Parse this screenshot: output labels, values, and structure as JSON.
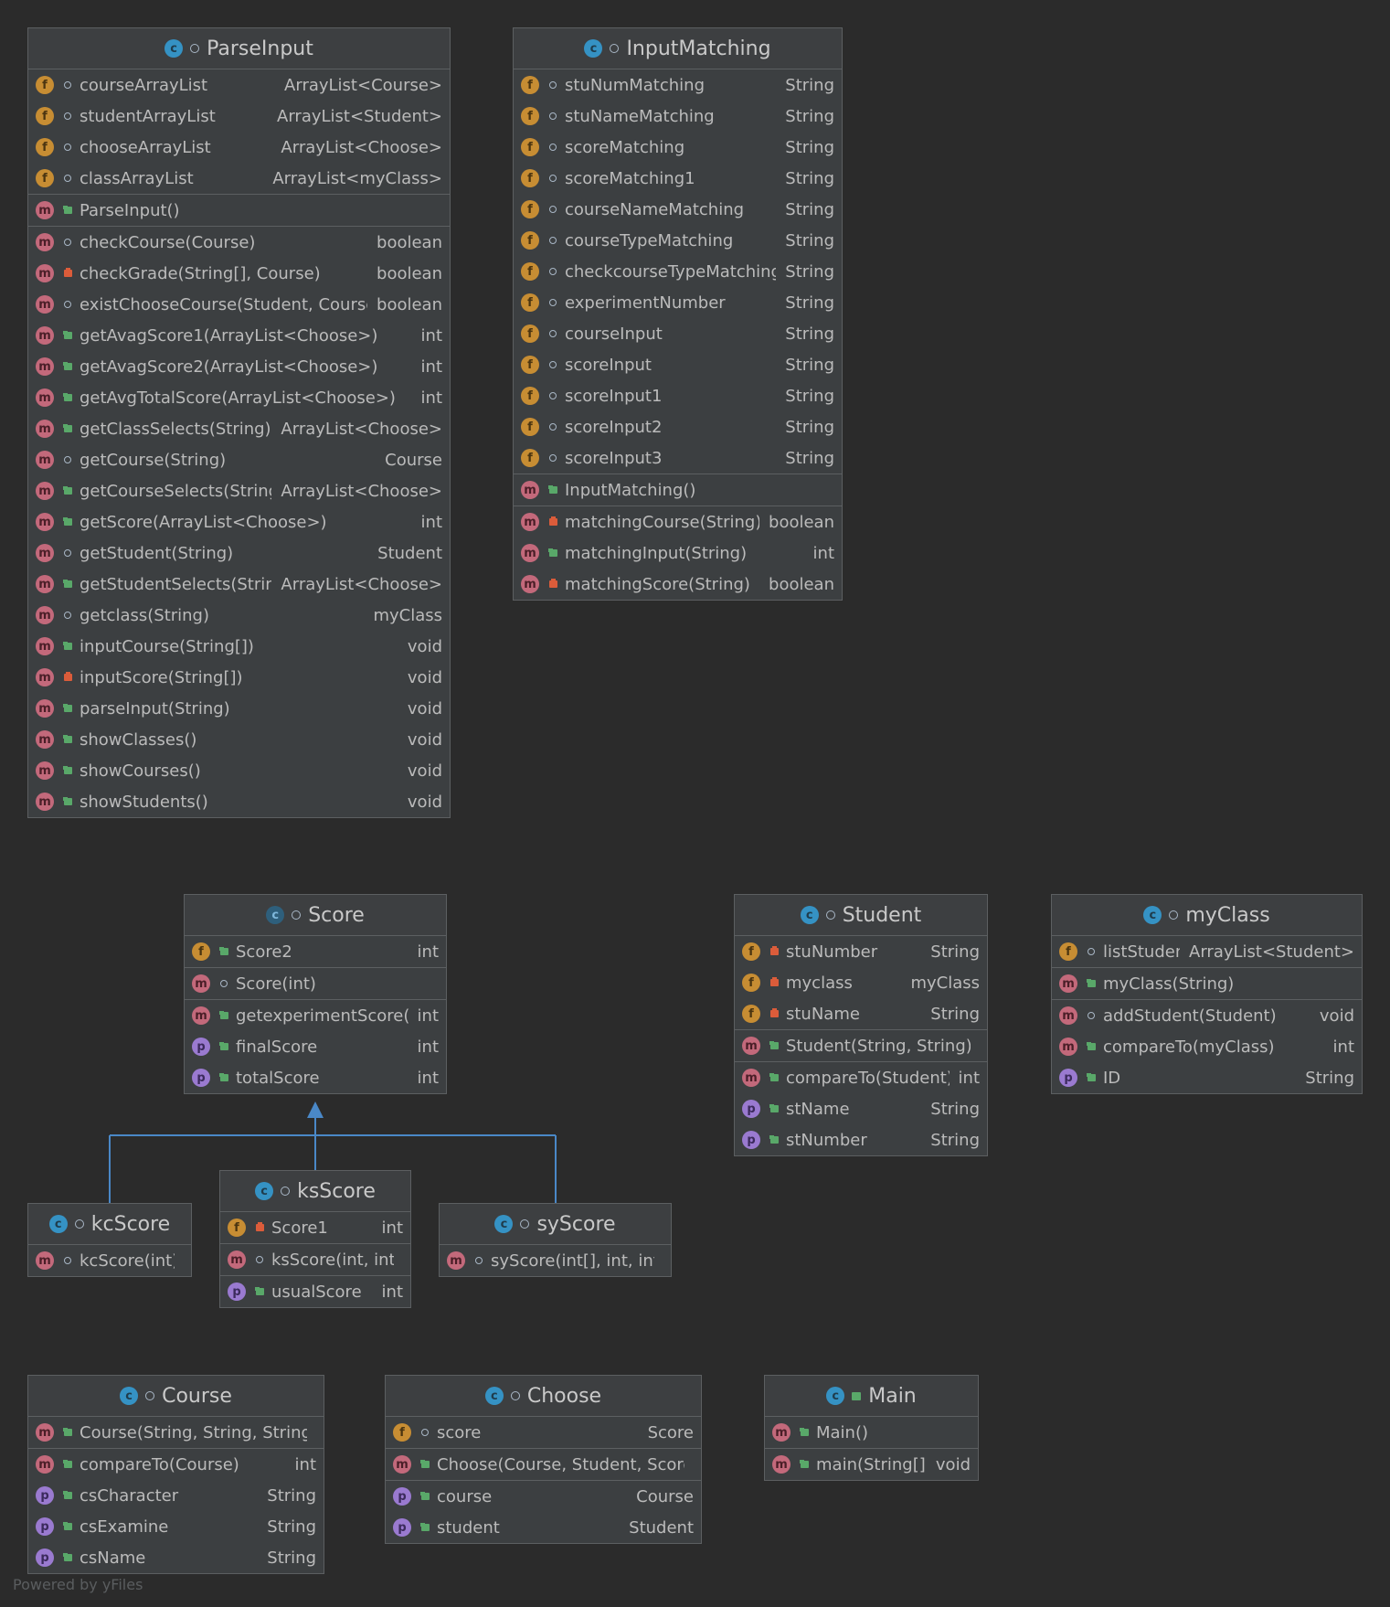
{
  "footer": "Powered by yFiles",
  "classes": [
    {
      "id": "ParseInput",
      "name": "ParseInput",
      "kind": "c",
      "vis": "pkg",
      "sections": [
        [
          {
            "k": "f",
            "v": "pkg",
            "n": "courseArrayList",
            "t": "ArrayList<Course>"
          },
          {
            "k": "f",
            "v": "pkg",
            "n": "studentArrayList",
            "t": "ArrayList<Student>"
          },
          {
            "k": "f",
            "v": "pkg",
            "n": "chooseArrayList",
            "t": "ArrayList<Choose>"
          },
          {
            "k": "f",
            "v": "pkg",
            "n": "classArrayList",
            "t": "ArrayList<myClass>"
          }
        ],
        [
          {
            "k": "m",
            "v": "pub",
            "n": "ParseInput()",
            "t": ""
          }
        ],
        [
          {
            "k": "m",
            "v": "pkg",
            "n": "checkCourse(Course)",
            "t": "boolean"
          },
          {
            "k": "m",
            "v": "priv",
            "n": "checkGrade(String[], Course)",
            "t": "boolean"
          },
          {
            "k": "m",
            "v": "pkg",
            "n": "existChooseCourse(Student, Course)",
            "t": "boolean"
          },
          {
            "k": "m",
            "v": "pub",
            "n": "getAvagScore1(ArrayList<Choose>)",
            "t": "int"
          },
          {
            "k": "m",
            "v": "pub",
            "n": "getAvagScore2(ArrayList<Choose>)",
            "t": "int"
          },
          {
            "k": "m",
            "v": "pub",
            "n": "getAvgTotalScore(ArrayList<Choose>)",
            "t": "int"
          },
          {
            "k": "m",
            "v": "pub",
            "n": "getClassSelects(String)",
            "t": "ArrayList<Choose>"
          },
          {
            "k": "m",
            "v": "pkg",
            "n": "getCourse(String)",
            "t": "Course"
          },
          {
            "k": "m",
            "v": "pub",
            "n": "getCourseSelects(String)",
            "t": "ArrayList<Choose>"
          },
          {
            "k": "m",
            "v": "pub",
            "n": "getScore(ArrayList<Choose>)",
            "t": "int"
          },
          {
            "k": "m",
            "v": "pkg",
            "n": "getStudent(String)",
            "t": "Student"
          },
          {
            "k": "m",
            "v": "pub",
            "n": "getStudentSelects(String)",
            "t": "ArrayList<Choose>"
          },
          {
            "k": "m",
            "v": "pkg",
            "n": "getclass(String)",
            "t": "myClass"
          },
          {
            "k": "m",
            "v": "pub",
            "n": "inputCourse(String[])",
            "t": "void"
          },
          {
            "k": "m",
            "v": "priv",
            "n": "inputScore(String[])",
            "t": "void"
          },
          {
            "k": "m",
            "v": "pub",
            "n": "parseInput(String)",
            "t": "void"
          },
          {
            "k": "m",
            "v": "pub",
            "n": "showClasses()",
            "t": "void"
          },
          {
            "k": "m",
            "v": "pub",
            "n": "showCourses()",
            "t": "void"
          },
          {
            "k": "m",
            "v": "pub",
            "n": "showStudents()",
            "t": "void"
          }
        ]
      ]
    },
    {
      "id": "InputMatching",
      "name": "InputMatching",
      "kind": "c",
      "vis": "pkg",
      "sections": [
        [
          {
            "k": "f",
            "v": "pkg",
            "n": "stuNumMatching",
            "t": "String"
          },
          {
            "k": "f",
            "v": "pkg",
            "n": "stuNameMatching",
            "t": "String"
          },
          {
            "k": "f",
            "v": "pkg",
            "n": "scoreMatching",
            "t": "String"
          },
          {
            "k": "f",
            "v": "pkg",
            "n": "scoreMatching1",
            "t": "String"
          },
          {
            "k": "f",
            "v": "pkg",
            "n": "courseNameMatching",
            "t": "String"
          },
          {
            "k": "f",
            "v": "pkg",
            "n": "courseTypeMatching",
            "t": "String"
          },
          {
            "k": "f",
            "v": "pkg",
            "n": "checkcourseTypeMatching",
            "t": "String"
          },
          {
            "k": "f",
            "v": "pkg",
            "n": "experimentNumber",
            "t": "String"
          },
          {
            "k": "f",
            "v": "pkg",
            "n": "courseInput",
            "t": "String"
          },
          {
            "k": "f",
            "v": "pkg",
            "n": "scoreInput",
            "t": "String"
          },
          {
            "k": "f",
            "v": "pkg",
            "n": "scoreInput1",
            "t": "String"
          },
          {
            "k": "f",
            "v": "pkg",
            "n": "scoreInput2",
            "t": "String"
          },
          {
            "k": "f",
            "v": "pkg",
            "n": "scoreInput3",
            "t": "String"
          }
        ],
        [
          {
            "k": "m",
            "v": "pub",
            "n": "InputMatching()",
            "t": ""
          }
        ],
        [
          {
            "k": "m",
            "v": "priv",
            "n": "matchingCourse(String)",
            "t": "boolean"
          },
          {
            "k": "m",
            "v": "pub",
            "n": "matchingInput(String)",
            "t": "int"
          },
          {
            "k": "m",
            "v": "priv",
            "n": "matchingScore(String)",
            "t": "boolean"
          }
        ]
      ]
    },
    {
      "id": "Score",
      "name": "Score",
      "kind": "a",
      "vis": "pkg",
      "sections": [
        [
          {
            "k": "f",
            "v": "pub",
            "n": "Score2",
            "t": "int"
          }
        ],
        [
          {
            "k": "m",
            "v": "pkg",
            "n": "Score(int)",
            "t": ""
          }
        ],
        [
          {
            "k": "m",
            "v": "pub",
            "n": "getexperimentScore()",
            "t": "int"
          },
          {
            "k": "p",
            "v": "pub",
            "n": "finalScore",
            "t": "int"
          },
          {
            "k": "p",
            "v": "pub",
            "n": "totalScore",
            "t": "int"
          }
        ]
      ]
    },
    {
      "id": "Student",
      "name": "Student",
      "kind": "c",
      "vis": "pkg",
      "sections": [
        [
          {
            "k": "f",
            "v": "priv",
            "n": "stuNumber",
            "t": "String"
          },
          {
            "k": "f",
            "v": "priv",
            "n": "myclass",
            "t": "myClass"
          },
          {
            "k": "f",
            "v": "priv",
            "n": "stuName",
            "t": "String"
          }
        ],
        [
          {
            "k": "m",
            "v": "pub",
            "n": "Student(String, String)",
            "t": ""
          }
        ],
        [
          {
            "k": "m",
            "v": "pub",
            "n": "compareTo(Student)",
            "t": "int"
          },
          {
            "k": "p",
            "v": "pub",
            "n": "stName",
            "t": "String"
          },
          {
            "k": "p",
            "v": "pub",
            "n": "stNumber",
            "t": "String"
          }
        ]
      ]
    },
    {
      "id": "myClass",
      "name": "myClass",
      "kind": "c",
      "vis": "pkg",
      "sections": [
        [
          {
            "k": "f",
            "v": "pkg",
            "n": "listStudent",
            "t": "ArrayList<Student>"
          }
        ],
        [
          {
            "k": "m",
            "v": "pub",
            "n": "myClass(String)",
            "t": ""
          }
        ],
        [
          {
            "k": "m",
            "v": "pkg",
            "n": "addStudent(Student)",
            "t": "void"
          },
          {
            "k": "m",
            "v": "pub",
            "n": "compareTo(myClass)",
            "t": "int"
          },
          {
            "k": "p",
            "v": "pub",
            "n": "ID",
            "t": "String"
          }
        ]
      ]
    },
    {
      "id": "kcScore",
      "name": "kcScore",
      "kind": "c",
      "vis": "pkg",
      "sections": [
        [
          {
            "k": "m",
            "v": "pkg",
            "n": "kcScore(int)",
            "t": ""
          }
        ]
      ]
    },
    {
      "id": "ksScore",
      "name": "ksScore",
      "kind": "c",
      "vis": "pkg",
      "sections": [
        [
          {
            "k": "f",
            "v": "priv",
            "n": "Score1",
            "t": "int"
          }
        ],
        [
          {
            "k": "m",
            "v": "pkg",
            "n": "ksScore(int, int)",
            "t": ""
          }
        ],
        [
          {
            "k": "p",
            "v": "pub",
            "n": "usualScore",
            "t": "int"
          }
        ]
      ]
    },
    {
      "id": "syScore",
      "name": "syScore",
      "kind": "c",
      "vis": "pkg",
      "sections": [
        [
          {
            "k": "m",
            "v": "pkg",
            "n": "syScore(int[], int, int)",
            "t": ""
          }
        ]
      ]
    },
    {
      "id": "Course",
      "name": "Course",
      "kind": "c",
      "vis": "pkg",
      "sections": [
        [
          {
            "k": "m",
            "v": "pub",
            "n": "Course(String, String, String)",
            "t": ""
          }
        ],
        [
          {
            "k": "m",
            "v": "pub",
            "n": "compareTo(Course)",
            "t": "int"
          },
          {
            "k": "p",
            "v": "pub",
            "n": "csCharacter",
            "t": "String"
          },
          {
            "k": "p",
            "v": "pub",
            "n": "csExamine",
            "t": "String"
          },
          {
            "k": "p",
            "v": "pub",
            "n": "csName",
            "t": "String"
          }
        ]
      ]
    },
    {
      "id": "Choose",
      "name": "Choose",
      "kind": "c",
      "vis": "pkg",
      "sections": [
        [
          {
            "k": "f",
            "v": "pkg",
            "n": "score",
            "t": "Score"
          }
        ],
        [
          {
            "k": "m",
            "v": "pub",
            "n": "Choose(Course, Student, Score)",
            "t": ""
          }
        ],
        [
          {
            "k": "p",
            "v": "pub",
            "n": "course",
            "t": "Course"
          },
          {
            "k": "p",
            "v": "pub",
            "n": "student",
            "t": "Student"
          }
        ]
      ]
    },
    {
      "id": "Main",
      "name": "Main",
      "kind": "c",
      "vis": "pub",
      "sections": [
        [
          {
            "k": "m",
            "v": "pub",
            "n": "Main()",
            "t": ""
          }
        ],
        [
          {
            "k": "m",
            "v": "pub",
            "n": "main(String[])",
            "t": "void"
          }
        ]
      ]
    }
  ],
  "colors": {
    "background": "#2b2b2b",
    "box": "#3c3f41",
    "border": "#5c5f61",
    "inheritance": "#4a88c7"
  }
}
